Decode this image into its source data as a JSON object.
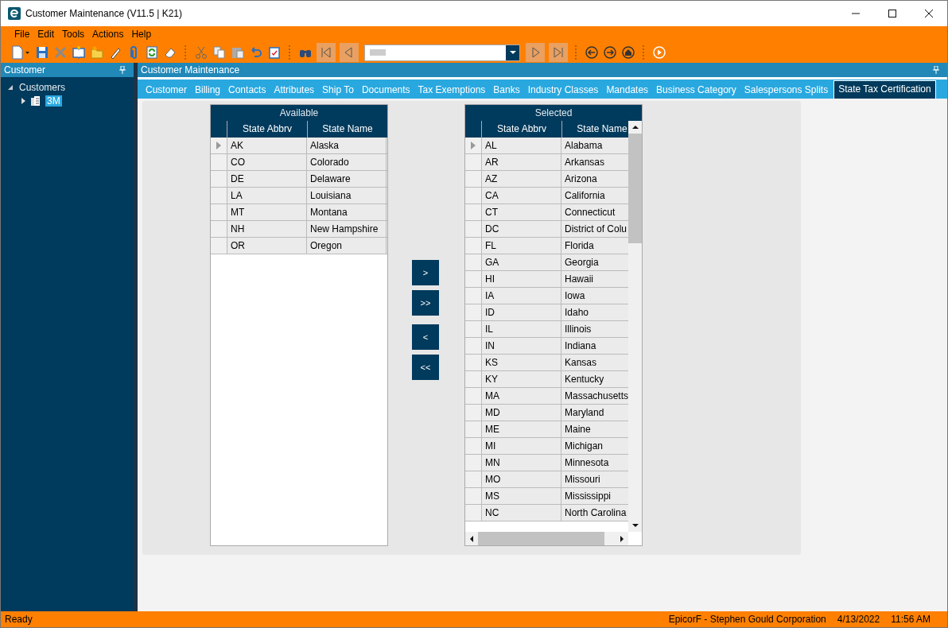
{
  "window": {
    "title": "Customer Maintenance (V11.5 | K21)"
  },
  "menu": [
    "File",
    "Edit",
    "Tools",
    "Actions",
    "Help"
  ],
  "record_nav": [
    {
      "kind": "first",
      "disabled": true
    },
    {
      "kind": "prev",
      "disabled": true
    },
    {
      "kind": "next",
      "disabled": true
    },
    {
      "kind": "last",
      "disabled": true
    }
  ],
  "sidebar": {
    "title": "Customer",
    "tree": [
      {
        "label": "Customers",
        "expanded": true,
        "children": [
          {
            "label": "3M",
            "selected": true,
            "expanded": false
          }
        ]
      }
    ]
  },
  "main": {
    "title": "Customer Maintenance",
    "tabs": [
      {
        "label": "Customer",
        "selected": false
      },
      {
        "label": "Billing",
        "selected": false
      },
      {
        "label": "Contacts",
        "selected": false
      },
      {
        "label": "Attributes",
        "selected": false
      },
      {
        "label": "Ship To",
        "selected": false
      },
      {
        "label": "Documents",
        "selected": false
      },
      {
        "label": "Tax Exemptions",
        "selected": false
      },
      {
        "label": "Banks",
        "selected": false
      },
      {
        "label": "Industry Classes",
        "selected": false
      },
      {
        "label": "Mandates",
        "selected": false
      },
      {
        "label": "Business Category",
        "selected": false
      },
      {
        "label": "Salespersons Splits",
        "selected": false
      },
      {
        "label": "State Tax Certification",
        "selected": true
      }
    ],
    "available": {
      "title": "Available",
      "columns": [
        "State Abbrv",
        "State Name"
      ],
      "rows": [
        {
          "cells": [
            "AK",
            "Alaska"
          ],
          "current": true
        },
        {
          "cells": [
            "CO",
            "Colorado"
          ],
          "current": false
        },
        {
          "cells": [
            "DE",
            "Delaware"
          ],
          "current": false
        },
        {
          "cells": [
            "LA",
            "Louisiana"
          ],
          "current": false
        },
        {
          "cells": [
            "MT",
            "Montana"
          ],
          "current": false
        },
        {
          "cells": [
            "NH",
            "New Hampshire"
          ],
          "current": false
        },
        {
          "cells": [
            "OR",
            "Oregon"
          ],
          "current": false
        }
      ]
    },
    "move_buttons": [
      ">",
      ">>",
      "<",
      "<<"
    ],
    "selected": {
      "title": "Selected",
      "columns": [
        "State Abbrv",
        "State Name"
      ],
      "rows": [
        {
          "cells": [
            "AL",
            "Alabama"
          ],
          "current": true
        },
        {
          "cells": [
            "AR",
            "Arkansas"
          ],
          "current": false
        },
        {
          "cells": [
            "AZ",
            "Arizona"
          ],
          "current": false
        },
        {
          "cells": [
            "CA",
            "California"
          ],
          "current": false
        },
        {
          "cells": [
            "CT",
            "Connecticut"
          ],
          "current": false
        },
        {
          "cells": [
            "DC",
            "District of Colu"
          ],
          "current": false
        },
        {
          "cells": [
            "FL",
            "Florida"
          ],
          "current": false
        },
        {
          "cells": [
            "GA",
            "Georgia"
          ],
          "current": false
        },
        {
          "cells": [
            "HI",
            "Hawaii"
          ],
          "current": false
        },
        {
          "cells": [
            "IA",
            "Iowa"
          ],
          "current": false
        },
        {
          "cells": [
            "ID",
            "Idaho"
          ],
          "current": false
        },
        {
          "cells": [
            "IL",
            "Illinois"
          ],
          "current": false
        },
        {
          "cells": [
            "IN",
            "Indiana"
          ],
          "current": false
        },
        {
          "cells": [
            "KS",
            "Kansas"
          ],
          "current": false
        },
        {
          "cells": [
            "KY",
            "Kentucky"
          ],
          "current": false
        },
        {
          "cells": [
            "MA",
            "Massachusetts"
          ],
          "current": false
        },
        {
          "cells": [
            "MD",
            "Maryland"
          ],
          "current": false
        },
        {
          "cells": [
            "ME",
            "Maine"
          ],
          "current": false
        },
        {
          "cells": [
            "MI",
            "Michigan"
          ],
          "current": false
        },
        {
          "cells": [
            "MN",
            "Minnesota"
          ],
          "current": false
        },
        {
          "cells": [
            "MO",
            "Missouri"
          ],
          "current": false
        },
        {
          "cells": [
            "MS",
            "Mississippi"
          ],
          "current": false
        },
        {
          "cells": [
            "NC",
            "North Carolina"
          ],
          "current": false
        }
      ]
    }
  },
  "status_bar": {
    "left": "Ready",
    "company": "EpicorF - Stephen Gould Corporation",
    "date": "4/13/2022",
    "time": "11:56 AM"
  }
}
